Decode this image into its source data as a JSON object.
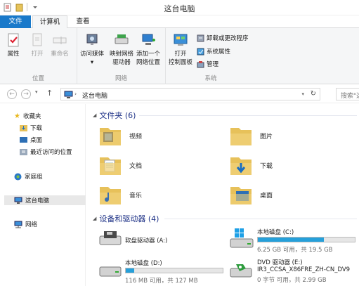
{
  "window": {
    "title": "这台电脑"
  },
  "tabs": {
    "file": "文件",
    "computer": "计算机",
    "view": "查看"
  },
  "ribbon": {
    "location": {
      "label": "位置",
      "properties": "属性",
      "open": "打开",
      "rename": "重命名"
    },
    "network": {
      "label": "网络",
      "access_media": "访问媒体",
      "map_drive_1": "映射网络",
      "map_drive_2": "驱动器",
      "add_location_1": "添加一个",
      "add_location_2": "网络位置"
    },
    "system": {
      "label": "系统",
      "open_cp_1": "打开",
      "open_cp_2": "控制面板",
      "uninstall": "卸载或更改程序",
      "sys_props": "系统属性",
      "manage": "管理"
    }
  },
  "address": {
    "path": "这台电脑",
    "search_placeholder": "搜索\"这"
  },
  "nav": {
    "favorites": "收藏夹",
    "downloads": "下载",
    "desktop": "桌面",
    "recent": "最近访问的位置",
    "homegroup": "家庭组",
    "this_pc": "这台电脑",
    "network": "网络"
  },
  "folders_section": {
    "title": "文件夹 (6)"
  },
  "folders": {
    "videos": "视频",
    "pictures": "图片",
    "documents": "文档",
    "downloads": "下载",
    "music": "音乐",
    "desktop": "桌面"
  },
  "devices_section": {
    "title": "设备和驱动器 (4)"
  },
  "drives": {
    "floppy": {
      "name": "软盘驱动器 (A:)"
    },
    "c": {
      "name": "本地磁盘 (C:)",
      "size": "6.25 GB 可用，共 19.5 GB",
      "used_fraction": 0.68
    },
    "d": {
      "name": "本地磁盘 (D:)",
      "size": "116 MB 可用，共 127 MB",
      "used_fraction": 0.09
    },
    "e": {
      "name": "DVD 驱动器 (E:)",
      "label": "IR3_CCSA_X86FRE_ZH-CN_DV9",
      "size": "0 字节 可用，共 2.99 GB"
    }
  },
  "colors": {
    "accent": "#1979ca",
    "drive_bar": "#26a0da",
    "section_title": "#1e3287"
  }
}
